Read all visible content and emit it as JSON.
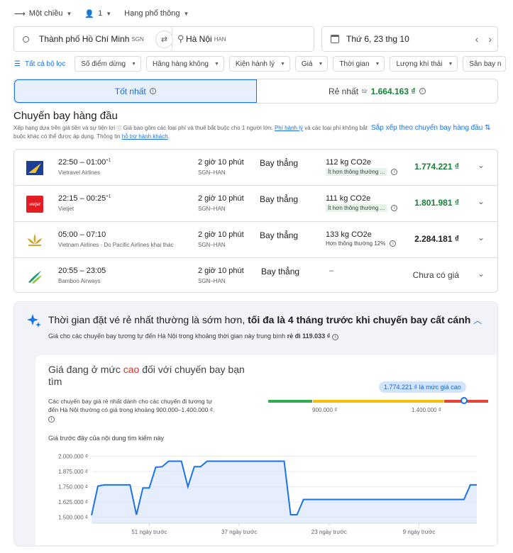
{
  "search": {
    "trip_type": "Một chiều",
    "passengers": "1",
    "cabin": "Hạng phổ thông",
    "origin": "Thành phố Hồ Chí Minh",
    "origin_code": "SGN",
    "destination": "Hà Nội",
    "destination_code": "HAN",
    "date": "Thứ 6, 23 thg 10"
  },
  "filters": {
    "all_label": "Tất cả bộ lọc",
    "chips": [
      "Số điểm dừng",
      "Hãng hàng không",
      "Kiện hành lý",
      "Giá",
      "Thời gian",
      "Lượng khí thải",
      "Sân bay n"
    ]
  },
  "tabs": {
    "best": "Tốt nhất",
    "cheapest": "Rẻ nhất",
    "cheapest_from": "từ",
    "cheapest_price": "1.664.163 ₫"
  },
  "section": {
    "title": "Chuyến bay hàng đầu",
    "desc_1": "Xếp hạng dựa trên giá tiền và sự tiện lợi",
    "desc_2": "Giá bao gồm các loại phí và thuế bắt buộc cho 1 người lớn.",
    "desc_link_1": "Phí hành lý",
    "desc_3": "và các loại phí không bắt buộc khác có thể được áp dụng. Thông tin",
    "desc_link_2": "hỗ trợ hành khách",
    "desc_4": ".",
    "sort_label": "Sắp xếp theo chuyến bay hàng đầu"
  },
  "flights": [
    {
      "time": "22:50 – 01:00",
      "plus": "+1",
      "airline": "Vietravel Airlines",
      "duration": "2 giờ 10 phút",
      "route": "SGN–HAN",
      "stops": "Bay thẳng",
      "co2": "112 kg CO2e",
      "emission": "Ít hơn thông thường ...",
      "price": "1.774.221 ₫"
    },
    {
      "time": "22:15 – 00:25",
      "plus": "+1",
      "airline": "Vietjet",
      "duration": "2 giờ 10 phút",
      "route": "SGN–HAN",
      "stops": "Bay thẳng",
      "co2": "111 kg CO2e",
      "emission": "Ít hơn thông thường ...",
      "price": "1.801.981 ₫"
    },
    {
      "time": "05:00 – 07:10",
      "plus": "",
      "airline": "Vietnam Airlines · Do Pacific Airlines khai thác",
      "duration": "2 giờ 10 phút",
      "route": "SGN–HAN",
      "stops": "Bay thẳng",
      "co2": "133 kg CO2e",
      "emission": "Hơn thông thường 12%",
      "price": "2.284.181 ₫"
    },
    {
      "time": "20:55 – 23:05",
      "plus": "",
      "airline": "Bamboo Airways",
      "duration": "2 giờ 10 phút",
      "route": "SGN–HAN",
      "stops": "Bay thẳng",
      "co2": "–",
      "emission": "",
      "price": "Chưa có giá"
    }
  ],
  "insight": {
    "title_1": "Thời gian đặt vé rẻ nhất thường là sớm hơn,",
    "title_2": "tối đa là 4 tháng trước khi chuyến bay cất cánh",
    "avg_text": "Giá cho các chuyến bay tương tự đến Hà Nội trong khoảng thời gian này trung bình",
    "avg_value": "rẻ đi 119.033 ₫",
    "level_pre": "Giá đang ở mức",
    "level_word": "cao",
    "level_post": "đối với chuyến bay bạn tìm",
    "level_desc": "Các chuyến bay giá rẻ nhất dành cho các chuyến đi tương tự đến Hà Nội thường có giá trong khoảng 900.000–1.400.000 ₫.",
    "gauge_low": "900.000 ₫",
    "gauge_high": "1.400.000 ₫",
    "gauge_bubble": "1.774.221 ₫ là mức giá cao",
    "history_title": "Giá trước đây của nội dung tìm kiếm này"
  },
  "chart_data": {
    "type": "area",
    "title": "Giá trước đây của nội dung tìm kiếm này",
    "ylabel": "",
    "ylim": [
      1450000,
      2050000
    ],
    "y_ticks": [
      "2.000.000 ₫",
      "1.875.000 ₫",
      "1.750.000 ₫",
      "1.625.000 ₫",
      "1.500.000 ₫"
    ],
    "y_tick_values": [
      2000000,
      1875000,
      1750000,
      1625000,
      1500000
    ],
    "x_tick_labels": [
      "51 ngày trước",
      "37 ngày trước",
      "23 ngày trước",
      "9 ngày trước"
    ],
    "x_tick_values": [
      51,
      37,
      23,
      9
    ],
    "x_range": [
      60,
      0
    ],
    "x": [
      60,
      59,
      58,
      54,
      53,
      52,
      51,
      50,
      49,
      48,
      46,
      45,
      44,
      43,
      42,
      39,
      38,
      37,
      30,
      29,
      28,
      27,
      26,
      2,
      1,
      0
    ],
    "values": [
      1515000,
      1755000,
      1765000,
      1765000,
      1520000,
      1740000,
      1740000,
      1910000,
      1915000,
      1960000,
      1960000,
      1750000,
      1915000,
      1915000,
      1960000,
      1960000,
      1960000,
      1960000,
      1960000,
      1520000,
      1520000,
      1645000,
      1645000,
      1645000,
      1765000,
      1765000
    ],
    "colors": {
      "line": "#1a73e8",
      "fill": "#dbe6fb"
    }
  },
  "colors": {
    "accent": "#1a73e8",
    "green": "#188038",
    "red": "#d93025",
    "gauge_green": "#34a853",
    "gauge_yellow": "#fbbc04",
    "gauge_red": "#ea4335"
  }
}
